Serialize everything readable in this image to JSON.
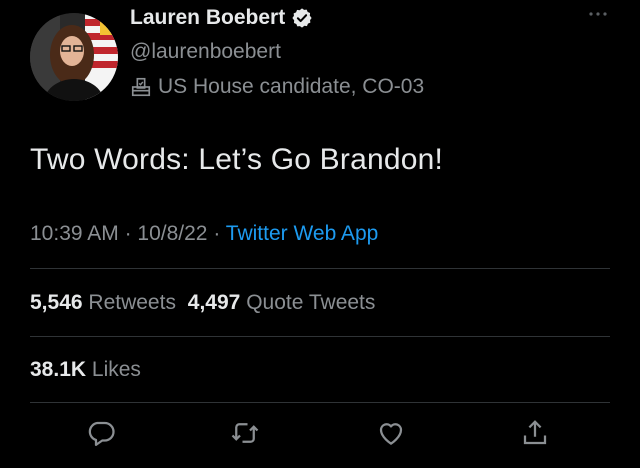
{
  "author": {
    "name": "Lauren Boebert",
    "handle": "@laurenboebert",
    "label": "US House candidate, CO-03",
    "verified": true
  },
  "tweet": {
    "text": "Two Words: Let’s Go Brandon!",
    "time": "10:39 AM",
    "date": "10/8/22",
    "separator": " · ",
    "source": "Twitter Web App"
  },
  "stats": {
    "retweets_count": "5,546",
    "retweets_label": "Retweets",
    "quotes_count": "4,497",
    "quotes_label": "Quote Tweets",
    "likes_count": "38.1K",
    "likes_label": "Likes"
  },
  "icons": {
    "verified": "verified-badge-icon",
    "label": "ballot-box-icon",
    "more": "more-options-icon",
    "reply": "reply-icon",
    "retweet": "retweet-icon",
    "like": "heart-icon",
    "share": "share-icon"
  },
  "colors": {
    "background": "#000000",
    "text": "#e7e9ea",
    "muted": "#8b8f93",
    "link": "#1d9bf0",
    "divider": "#2f3336"
  }
}
